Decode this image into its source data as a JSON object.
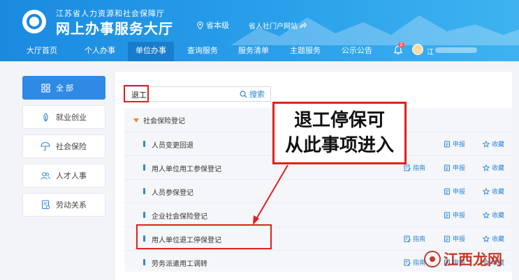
{
  "header": {
    "org_name": "江苏省人力资源和社会保障厅",
    "hall_name": "网上办事服务大厅",
    "level": "省本级",
    "portal_link": "省人社门户网站",
    "nav": [
      "大厅首页",
      "个人办事",
      "单位办事",
      "查询服务",
      "服务清单",
      "主题服务",
      "公示公告"
    ],
    "active_nav": "单位办事",
    "notification_count": "2",
    "user_name": "江",
    "colors": {
      "header_start": "#1a8ae0",
      "header_end": "#3fb3f0"
    }
  },
  "sidebar": {
    "items": [
      {
        "label": "全 部",
        "icon": "grid-icon",
        "active": true
      },
      {
        "label": "就业创业",
        "icon": "leaf-icon",
        "active": false
      },
      {
        "label": "社会保险",
        "icon": "umbrella-icon",
        "active": false
      },
      {
        "label": "人才人事",
        "icon": "people-icon",
        "active": false
      },
      {
        "label": "劳动关系",
        "icon": "document-icon",
        "active": false
      }
    ]
  },
  "search": {
    "value": "退工",
    "button_label": "搜索"
  },
  "category": {
    "label": "社会保险登记"
  },
  "rows": [
    {
      "name": "人员变更回退",
      "guide": "",
      "apply": "申报",
      "fav": "收藏"
    },
    {
      "name": "用人单位用工参保登记",
      "guide": "指南",
      "apply": "申报",
      "fav": "收藏"
    },
    {
      "name": "人员参保登记",
      "guide": "",
      "apply": "申报",
      "fav": "收藏"
    },
    {
      "name": "企业社会保险登记",
      "guide": "",
      "apply": "申报",
      "fav": "收藏"
    },
    {
      "name": "用人单位退工停保登记",
      "guide": "指南",
      "apply": "申报",
      "fav": "收藏"
    },
    {
      "name": "劳务派遣用工调转",
      "guide": "指南",
      "apply": "申报",
      "fav": "收藏"
    }
  ],
  "annotation": {
    "line1": "退工停保可",
    "line2": "从此事项进入",
    "color": "#e0211b"
  },
  "watermark": "江西龙网"
}
